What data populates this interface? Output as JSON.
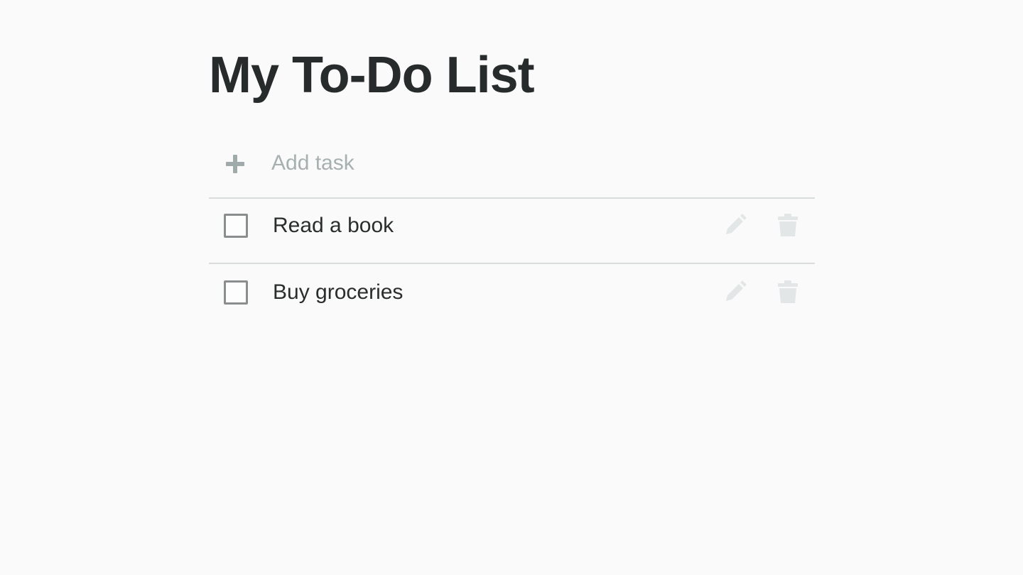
{
  "page": {
    "title": "My To-Do List"
  },
  "add_task": {
    "placeholder": "Add task",
    "value": "",
    "icon": "plus-icon"
  },
  "tasks": [
    {
      "label": "Read a book",
      "completed": false,
      "edit_icon": "pencil-icon",
      "delete_icon": "trash-icon"
    },
    {
      "label": "Buy groceries",
      "completed": false,
      "edit_icon": "pencil-icon",
      "delete_icon": "trash-icon"
    }
  ],
  "colors": {
    "background": "#fafafa",
    "title": "#272b2b",
    "text": "#2a2d2d",
    "placeholder": "#a7b0b0",
    "divider": "#d9dcdc",
    "checkbox_border": "#8b8e8e",
    "action_icon": "#e3e6e6",
    "plus_icon": "#a1aaaa"
  }
}
